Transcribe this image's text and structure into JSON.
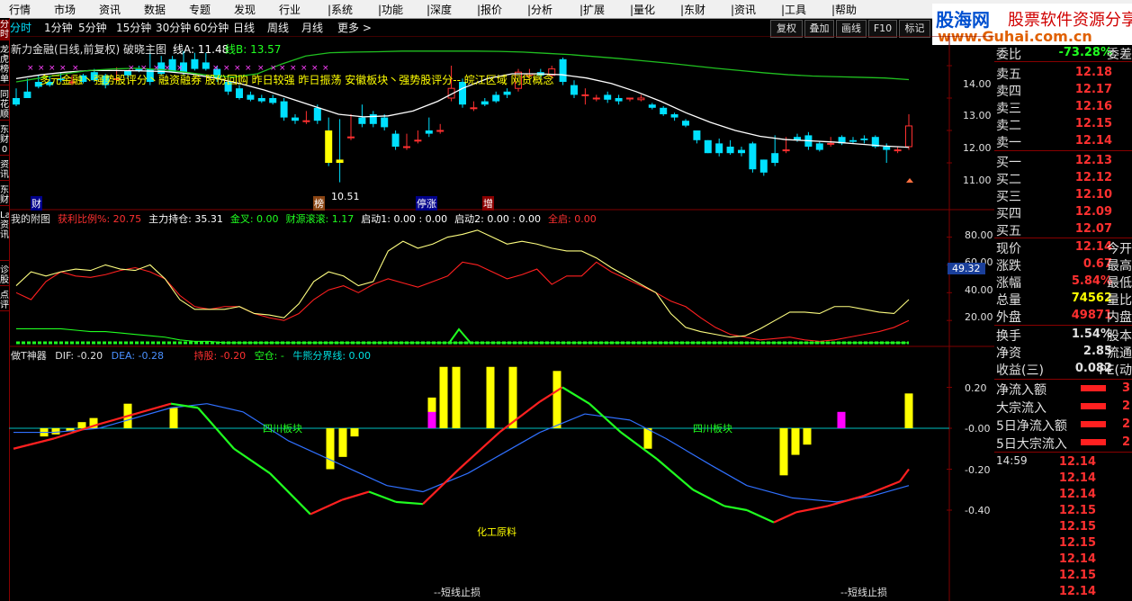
{
  "menu": [
    "行情",
    "市场",
    "资讯",
    "数据",
    "专题",
    "发现",
    "行业",
    "|系统",
    "|功能",
    "|深度",
    "|报价",
    "|分析",
    "|扩展",
    "|量化",
    "|东财",
    "|资讯",
    "|工具",
    "|帮助"
  ],
  "left_tabs": [
    "分时",
    "龙虎榜单",
    "同花顺",
    "东财0",
    "资讯",
    "东财",
    "Lad资讯",
    "诊股",
    "点评"
  ],
  "timeframes": [
    "分时",
    "1分钟",
    "5分钟",
    "15分钟",
    "30分钟",
    "60分钟",
    "日线",
    "周线",
    "月线",
    "更多 >"
  ],
  "toolbar": [
    "复权",
    "叠加",
    "画线",
    "F10",
    "标记"
  ],
  "logo": {
    "brand": "股海网",
    "slogan": "股票软件资源分享",
    "url": "www.Guhai.com.cn"
  },
  "main_chart": {
    "header": "新力金融(日线,前复权) 破晓主图",
    "lineA_label": "线A: 11.48",
    "lineB_label": "线B: 13.57",
    "concepts": "多元金融丶强势股评分丶融资融券 股份回购 昨日较强 昨日振荡 安徽板块丶强势股评分-- 皖江区域 网贷概念",
    "low_label": "10.51",
    "markers": [
      "财",
      "榜",
      "停涨",
      "增"
    ],
    "y_labels": [
      "14.00",
      "13.00",
      "12.00",
      "11.00"
    ]
  },
  "chart_data": [
    {
      "type": "candlestick",
      "title": "新力金融(日线,前复权) 破晓主图",
      "ylim": [
        10.4,
        15.1
      ],
      "y_ticks": [
        11.0,
        12.0,
        13.0,
        14.0
      ],
      "candles": [
        [
          13.0,
          13.3,
          12.8,
          12.75
        ],
        [
          13.2,
          13.6,
          13.0,
          13.1
        ],
        [
          13.5,
          13.7,
          13.35,
          13.3
        ],
        [
          13.5,
          13.65,
          13.4,
          13.35
        ],
        [
          13.6,
          13.8,
          13.55,
          13.5
        ],
        [
          13.5,
          13.7,
          13.5,
          13.4
        ],
        [
          13.7,
          13.75,
          13.5,
          13.45
        ],
        [
          13.8,
          13.9,
          13.55,
          13.5
        ],
        [
          13.7,
          13.75,
          13.4,
          13.3
        ],
        [
          13.6,
          13.95,
          13.6,
          13.5
        ],
        [
          13.85,
          13.85,
          13.7,
          13.6
        ],
        [
          13.9,
          14.0,
          13.85,
          13.8
        ],
        [
          13.9,
          14.45,
          13.5,
          13.4
        ],
        [
          14.1,
          14.3,
          13.75,
          13.7
        ],
        [
          14.2,
          14.3,
          13.8,
          13.8
        ],
        [
          14.1,
          14.45,
          13.8,
          13.7
        ],
        [
          14.2,
          14.4,
          13.9,
          13.85
        ],
        [
          14.1,
          14.4,
          13.9,
          13.85
        ],
        [
          13.9,
          14.0,
          13.6,
          13.5
        ],
        [
          13.5,
          13.6,
          13.2,
          13.1
        ],
        [
          13.3,
          13.4,
          13.0,
          12.95
        ],
        [
          13.1,
          13.2,
          12.95,
          12.9
        ],
        [
          13.0,
          13.1,
          12.9,
          12.85
        ],
        [
          13.0,
          13.1,
          12.85,
          12.8
        ],
        [
          12.9,
          13.0,
          12.4,
          12.3
        ],
        [
          12.4,
          12.5,
          12.3,
          12.2
        ],
        [
          12.3,
          12.6,
          12.3,
          12.2
        ],
        [
          12.7,
          12.8,
          12.3,
          12.2
        ],
        [
          12.0,
          12.4,
          11.0,
          10.9
        ],
        [
          11.1,
          12.35,
          11.0,
          10.4
        ],
        [
          11.8,
          12.5,
          11.8,
          11.7
        ],
        [
          12.4,
          12.8,
          12.2,
          12.1
        ],
        [
          12.5,
          12.6,
          12.2,
          12.1
        ],
        [
          12.4,
          12.5,
          12.1,
          12.0
        ],
        [
          11.9,
          12.0,
          11.5,
          11.4
        ],
        [
          11.5,
          11.9,
          11.5,
          11.4
        ],
        [
          11.7,
          12.0,
          11.7,
          11.6
        ],
        [
          12.0,
          12.4,
          11.9,
          11.8
        ],
        [
          12.0,
          12.2,
          12.0,
          11.9
        ],
        [
          13.0,
          14.0,
          13.3,
          12.9
        ],
        [
          13.5,
          13.6,
          12.8,
          12.7
        ],
        [
          12.7,
          12.9,
          12.7,
          12.6
        ],
        [
          12.9,
          13.0,
          12.8,
          12.75
        ],
        [
          13.1,
          13.2,
          12.9,
          12.85
        ],
        [
          13.2,
          13.3,
          13.1,
          13.0
        ],
        [
          13.3,
          13.9,
          13.8,
          13.2
        ],
        [
          13.7,
          13.9,
          13.75,
          13.6
        ],
        [
          13.8,
          13.9,
          13.7,
          13.6
        ],
        [
          13.7,
          14.0,
          13.9,
          13.6
        ],
        [
          14.2,
          14.25,
          13.5,
          13.4
        ],
        [
          13.4,
          13.55,
          13.1,
          13.0
        ],
        [
          13.1,
          13.3,
          13.1,
          12.8
        ],
        [
          13.0,
          13.1,
          13.0,
          12.9
        ],
        [
          13.1,
          13.2,
          12.95,
          12.85
        ],
        [
          13.0,
          13.1,
          12.9,
          12.8
        ],
        [
          13.0,
          13.0,
          13.0,
          12.9
        ],
        [
          12.95,
          13.1,
          13.0,
          12.9
        ],
        [
          12.8,
          12.85,
          12.7,
          12.65
        ],
        [
          12.7,
          12.75,
          12.5,
          12.45
        ],
        [
          12.5,
          12.55,
          12.4,
          12.3
        ],
        [
          12.3,
          12.35,
          12.15,
          12.1
        ],
        [
          12.0,
          12.0,
          11.7,
          11.6
        ],
        [
          11.7,
          11.7,
          11.3,
          11.3
        ],
        [
          11.6,
          11.75,
          11.3,
          11.2
        ],
        [
          11.5,
          11.7,
          11.3,
          11.25
        ],
        [
          11.4,
          11.5,
          11.3,
          11.2
        ],
        [
          11.6,
          11.65,
          10.8,
          10.7
        ],
        [
          11.1,
          11.1,
          10.7,
          10.6
        ],
        [
          11.3,
          11.85,
          11.0,
          10.9
        ],
        [
          11.4,
          11.8,
          11.4,
          11.3
        ],
        [
          11.8,
          11.9,
          11.7,
          11.65
        ],
        [
          11.85,
          11.95,
          11.5,
          11.4
        ],
        [
          11.6,
          11.65,
          11.4,
          11.35
        ],
        [
          11.6,
          11.8,
          11.6,
          11.5
        ],
        [
          11.8,
          11.85,
          11.6,
          11.55
        ],
        [
          11.7,
          11.8,
          11.65,
          11.6
        ],
        [
          11.75,
          11.85,
          11.7,
          11.6
        ],
        [
          11.8,
          11.85,
          11.5,
          11.45
        ],
        [
          11.5,
          11.6,
          11.4,
          11.0
        ],
        [
          11.4,
          11.5,
          11.4,
          11.3
        ],
        [
          11.5,
          12.5,
          12.14,
          11.4
        ]
      ],
      "ma_long": [
        13.6,
        13.72,
        13.8,
        13.85,
        13.85,
        13.84,
        13.82,
        13.75,
        13.62,
        13.45,
        13.25,
        13.0,
        12.75,
        12.5,
        12.42,
        12.45,
        12.6,
        12.9,
        13.3,
        13.6,
        13.75,
        13.75,
        13.72,
        13.62,
        13.45,
        13.2,
        12.9,
        12.55,
        12.25,
        12.0,
        11.82,
        11.72,
        11.68,
        11.64,
        11.58,
        11.52,
        11.48
      ],
      "ma_short": [
        13.5,
        13.62,
        13.75,
        13.85,
        13.9,
        13.92,
        13.88,
        13.8,
        13.7,
        13.65,
        13.75,
        14.05,
        14.3,
        14.4,
        14.42,
        14.43,
        14.45,
        14.45,
        14.45,
        14.45,
        14.44,
        14.42,
        14.38,
        14.34,
        14.28,
        14.22,
        14.15,
        14.08,
        14.0,
        13.92,
        13.85,
        13.78,
        13.72,
        13.68,
        13.66,
        13.64,
        13.62,
        13.57
      ]
    },
    {
      "type": "line",
      "title": "我的附图",
      "ylim": [
        2,
        92
      ],
      "y_ticks": [
        20,
        40,
        60,
        80
      ],
      "current_value": 49.32,
      "series": [
        {
          "name": "获利比例%",
          "values": [
            40,
            35,
            48,
            55,
            52,
            51,
            53,
            56,
            58,
            55,
            50,
            38,
            30,
            28,
            30,
            30,
            25,
            22,
            20,
            25,
            35,
            42,
            45,
            40,
            46,
            50,
            47,
            44,
            48,
            52,
            62,
            60,
            55,
            50,
            53,
            57,
            46,
            52,
            52,
            62,
            55,
            50,
            45,
            40,
            34,
            30,
            22,
            15,
            10,
            8,
            6,
            7,
            8,
            6,
            5,
            6,
            8,
            10,
            12,
            15,
            20
          ]
        },
        {
          "name": "主力持仓",
          "values": [
            45,
            55,
            52,
            55,
            57,
            56,
            60,
            57,
            56,
            60,
            50,
            35,
            28,
            28,
            28,
            30,
            25,
            24,
            22,
            32,
            48,
            55,
            52,
            45,
            48,
            70,
            77,
            72,
            75,
            80,
            82,
            85,
            80,
            75,
            77,
            75,
            72,
            70,
            70,
            65,
            58,
            52,
            46,
            40,
            25,
            15,
            12,
            10,
            8,
            9,
            14,
            20,
            26,
            26,
            25,
            30,
            30,
            28,
            26,
            25,
            35
          ]
        },
        {
          "name": "金叉",
          "values": [
            14,
            14,
            14,
            14,
            13,
            12,
            12,
            11,
            10,
            9,
            8,
            6,
            5,
            5,
            4,
            4,
            4,
            4,
            4,
            4,
            4,
            4,
            4,
            4,
            4,
            4,
            4,
            4,
            4,
            4,
            4,
            4,
            4,
            4,
            4,
            4,
            4,
            4,
            4,
            4,
            4,
            4,
            4,
            4,
            4,
            4,
            4,
            4,
            4,
            4,
            4,
            4,
            4,
            4,
            4,
            4,
            4,
            4,
            4,
            4,
            4
          ]
        }
      ]
    },
    {
      "type": "bar",
      "title": "做T神器",
      "ylim": [
        -0.55,
        0.27
      ],
      "y_ticks": [
        0.2,
        0.0,
        -0.2,
        -0.4
      ],
      "bars_yellow": [
        [
          49,
          -0.04
        ],
        [
          62,
          -0.03
        ],
        [
          78,
          -0.015
        ],
        [
          91,
          0.03
        ],
        [
          104,
          0.05
        ],
        [
          142,
          0.12
        ],
        [
          193,
          0.1
        ],
        [
          367,
          -0.2
        ],
        [
          381,
          -0.14
        ],
        [
          394,
          -0.04
        ],
        [
          480,
          0.15
        ],
        [
          493,
          0.3
        ],
        [
          507,
          0.3
        ],
        [
          545,
          0.3
        ],
        [
          570,
          0.3
        ],
        [
          619,
          0.28
        ],
        [
          720,
          -0.1
        ],
        [
          871,
          -0.23
        ],
        [
          884,
          -0.13
        ],
        [
          897,
          -0.08
        ],
        [
          1010,
          0.17
        ]
      ],
      "bars_magenta": [
        [
          480,
          0.08
        ],
        [
          935,
          0.08
        ]
      ],
      "dif": [
        [
          15,
          -0.1
        ],
        [
          60,
          -0.05
        ],
        [
          110,
          0.02
        ],
        [
          190,
          0.12
        ],
        [
          220,
          0.1
        ],
        [
          260,
          -0.1
        ],
        [
          300,
          -0.22
        ],
        [
          345,
          -0.42
        ],
        [
          380,
          -0.35
        ],
        [
          410,
          -0.31
        ],
        [
          440,
          -0.36
        ],
        [
          470,
          -0.37
        ],
        [
          510,
          -0.2
        ],
        [
          555,
          -0.02
        ],
        [
          600,
          0.13
        ],
        [
          625,
          0.2
        ],
        [
          655,
          0.12
        ],
        [
          690,
          -0.02
        ],
        [
          730,
          -0.15
        ],
        [
          770,
          -0.3
        ],
        [
          805,
          -0.38
        ],
        [
          830,
          -0.4
        ],
        [
          860,
          -0.46
        ],
        [
          885,
          -0.41
        ],
        [
          920,
          -0.38
        ],
        [
          960,
          -0.33
        ],
        [
          1000,
          -0.26
        ],
        [
          1010,
          -0.2
        ]
      ],
      "dea": [
        [
          15,
          -0.02
        ],
        [
          60,
          -0.02
        ],
        [
          110,
          0.0
        ],
        [
          190,
          0.1
        ],
        [
          230,
          0.12
        ],
        [
          270,
          0.08
        ],
        [
          320,
          -0.06
        ],
        [
          380,
          -0.18
        ],
        [
          430,
          -0.28
        ],
        [
          470,
          -0.31
        ],
        [
          520,
          -0.22
        ],
        [
          560,
          -0.12
        ],
        [
          600,
          -0.02
        ],
        [
          650,
          0.07
        ],
        [
          700,
          0.04
        ],
        [
          740,
          -0.05
        ],
        [
          790,
          -0.18
        ],
        [
          830,
          -0.28
        ],
        [
          880,
          -0.34
        ],
        [
          930,
          -0.36
        ],
        [
          970,
          -0.33
        ],
        [
          1010,
          -0.28
        ]
      ]
    }
  ],
  "sub1": {
    "title": "我的附图",
    "items": [
      {
        "label": "获利比例%: 20.75",
        "color": "#ff3030"
      },
      {
        "label": "主力持仓: 35.31",
        "color": "#ffffff"
      },
      {
        "label": "金叉: 0.00",
        "color": "#20ff20"
      },
      {
        "label": "财源滚滚: 1.17",
        "color": "#20ff20"
      },
      {
        "label": "启动1: 0.00 : 0.00",
        "color": "#ffffff"
      },
      {
        "label": "启动2: 0.00 : 0.00",
        "color": "#ffffff"
      },
      {
        "label": "全启: 0.00",
        "color": "#ff3030"
      }
    ],
    "y_labels": [
      "80.00",
      "60.00",
      "40.00",
      "20.00"
    ],
    "current": "49.32"
  },
  "sub2": {
    "title": "做T神器",
    "dif": "DIF: -0.20",
    "dea": "DEA: -0.28",
    "hold": "持股: -0.20",
    "empty": "空仓: -",
    "bull": "牛熊分界线: 0.00",
    "y_labels": [
      "0.20",
      "-0.00",
      "-0.20",
      "-0.40"
    ],
    "board_label": "四川板块",
    "industry": "化工原料",
    "stop_label": "--短线止损"
  },
  "quote": {
    "committee_label": "委比",
    "committee_value": "-73.28%",
    "committee_right": "委差",
    "asks": [
      {
        "label": "卖五",
        "price": "12.18"
      },
      {
        "label": "卖四",
        "price": "12.17"
      },
      {
        "label": "卖三",
        "price": "12.16"
      },
      {
        "label": "卖二",
        "price": "12.15"
      },
      {
        "label": "卖一",
        "price": "12.14"
      }
    ],
    "bids": [
      {
        "label": "买一",
        "price": "12.13"
      },
      {
        "label": "买二",
        "price": "12.12"
      },
      {
        "label": "买三",
        "price": "12.10"
      },
      {
        "label": "买四",
        "price": "12.09"
      },
      {
        "label": "买五",
        "price": "12.07"
      }
    ],
    "stats": [
      {
        "label": "现价",
        "value": "12.14",
        "right": "今开",
        "color": "#ff3030"
      },
      {
        "label": "涨跌",
        "value": "0.67",
        "right": "最高",
        "color": "#ff3030"
      },
      {
        "label": "涨幅",
        "value": "5.84%",
        "right": "最低",
        "color": "#ff3030"
      },
      {
        "label": "总量",
        "value": "74562",
        "right": "量比",
        "color": "#ffff00"
      },
      {
        "label": "外盘",
        "value": "49871",
        "right": "内盘",
        "color": "#ff3030"
      }
    ],
    "stats2": [
      {
        "label": "换手",
        "value": "1.54%",
        "right": "股本"
      },
      {
        "label": "净资",
        "value": "2.85",
        "right": "流通"
      },
      {
        "label": "收益(三)",
        "value": "0.082",
        "right": "PE(动"
      }
    ],
    "flows": [
      {
        "label": "净流入额",
        "value": "3"
      },
      {
        "label": "大宗流入",
        "value": "2"
      },
      {
        "label": "5日净流入额",
        "value": "2"
      },
      {
        "label": "5日大宗流入",
        "value": "2"
      }
    ],
    "time": "14:59",
    "ticks": [
      "12.14",
      "12.14",
      "12.14",
      "12.15",
      "12.15",
      "12.15",
      "12.14",
      "12.15",
      "12.14"
    ]
  }
}
